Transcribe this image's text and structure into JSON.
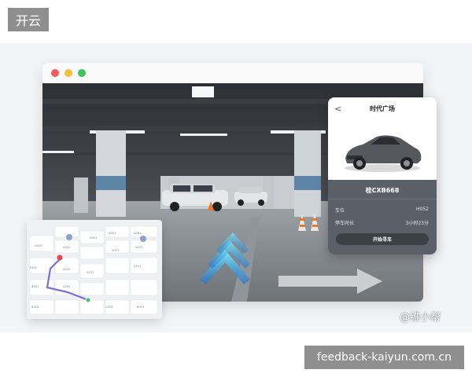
{
  "badge": "开云",
  "phone": {
    "title": "时代广场",
    "back_glyph": "<",
    "plate": "桂CXB668",
    "rows": [
      {
        "label": "车位",
        "value": "H052"
      },
      {
        "label": "停车时长",
        "value": "3小时23分"
      }
    ],
    "button_label": "开始寻车"
  },
  "map_labels": [
    "A001",
    "A021",
    "H018",
    "A031",
    "F001",
    "A051",
    "A061",
    "A071",
    "A041",
    "A201",
    "A101",
    "A151",
    "B001",
    "B018",
    "C021",
    "B021"
  ],
  "watermark": "@维小帮",
  "feedback": "feedback-kaiyun.com.cn",
  "colors": {
    "accent_teal": "#25c6d8",
    "pin_red": "#e8454f",
    "route_purple": "#7b6cd9",
    "panel_gray": "#5a5f68"
  }
}
